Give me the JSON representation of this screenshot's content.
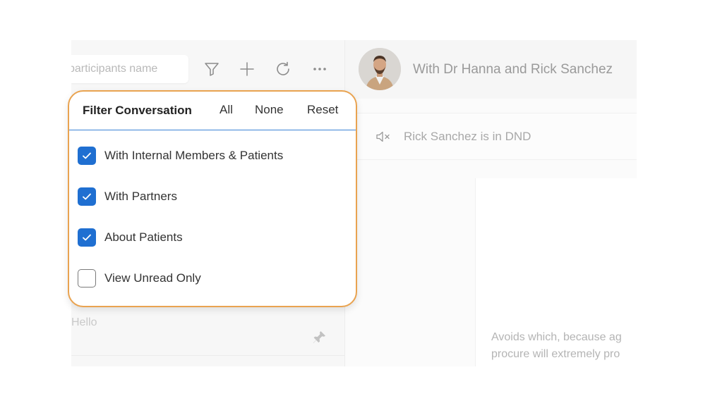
{
  "search": {
    "placeholder": "participants name"
  },
  "toolbar": {
    "filter_icon": "filter-icon",
    "add_icon": "plus-icon",
    "refresh_icon": "refresh-icon",
    "more_icon": "more-horizontal-icon"
  },
  "conversation_preview": {
    "text": "Hello"
  },
  "chat": {
    "title": "With Dr Hanna and Rick Sanchez",
    "status": "Rick Sanchez is in DND",
    "message": [
      "Avoids which, because ag",
      "procure will extremely pro"
    ]
  },
  "filter": {
    "title": "Filter Conversation",
    "all_label": "All",
    "none_label": "None",
    "reset_label": "Reset",
    "options": [
      {
        "label": "With Internal Members & Patients",
        "checked": true
      },
      {
        "label": "With Partners",
        "checked": true
      },
      {
        "label": "About Patients",
        "checked": true
      },
      {
        "label": "View Unread Only",
        "checked": false
      }
    ]
  },
  "colors": {
    "accent": "#1f6fd1",
    "panel_border": "#e9a350",
    "divider": "#3b82d6"
  }
}
